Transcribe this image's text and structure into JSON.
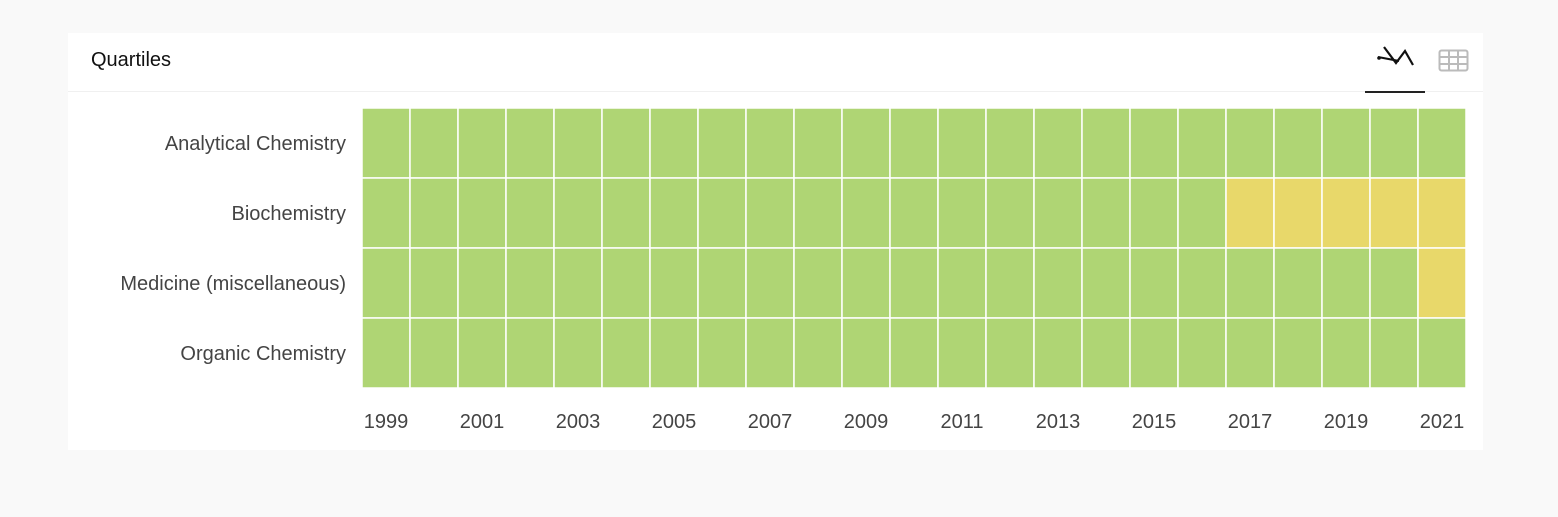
{
  "card": {
    "title": "Quartiles"
  },
  "toolbar": {
    "chart_view_icon": "line-chart-icon",
    "table_view_icon": "table-grid-icon",
    "active_view": "chart"
  },
  "chart_data": {
    "type": "heatmap",
    "title": "",
    "categories_y": [
      "Analytical Chemistry",
      "Biochemistry",
      "Medicine (miscellaneous)",
      "Organic Chemistry"
    ],
    "years": [
      1999,
      2000,
      2001,
      2002,
      2003,
      2004,
      2005,
      2006,
      2007,
      2008,
      2009,
      2010,
      2011,
      2012,
      2013,
      2014,
      2015,
      2016,
      2017,
      2018,
      2019,
      2020,
      2021
    ],
    "x_tick_labels": [
      "1999",
      "2001",
      "2003",
      "2005",
      "2007",
      "2009",
      "2011",
      "2013",
      "2015",
      "2017",
      "2019",
      "2021"
    ],
    "values": [
      [
        "Q1",
        "Q1",
        "Q1",
        "Q1",
        "Q1",
        "Q1",
        "Q1",
        "Q1",
        "Q1",
        "Q1",
        "Q1",
        "Q1",
        "Q1",
        "Q1",
        "Q1",
        "Q1",
        "Q1",
        "Q1",
        "Q1",
        "Q1",
        "Q1",
        "Q1",
        "Q1"
      ],
      [
        "Q1",
        "Q1",
        "Q1",
        "Q1",
        "Q1",
        "Q1",
        "Q1",
        "Q1",
        "Q1",
        "Q1",
        "Q1",
        "Q1",
        "Q1",
        "Q1",
        "Q1",
        "Q1",
        "Q1",
        "Q1",
        "Q2",
        "Q2",
        "Q2",
        "Q2",
        "Q2"
      ],
      [
        "Q1",
        "Q1",
        "Q1",
        "Q1",
        "Q1",
        "Q1",
        "Q1",
        "Q1",
        "Q1",
        "Q1",
        "Q1",
        "Q1",
        "Q1",
        "Q1",
        "Q1",
        "Q1",
        "Q1",
        "Q1",
        "Q1",
        "Q1",
        "Q1",
        "Q1",
        "Q2"
      ],
      [
        "Q1",
        "Q1",
        "Q1",
        "Q1",
        "Q1",
        "Q1",
        "Q1",
        "Q1",
        "Q1",
        "Q1",
        "Q1",
        "Q1",
        "Q1",
        "Q1",
        "Q1",
        "Q1",
        "Q1",
        "Q1",
        "Q1",
        "Q1",
        "Q1",
        "Q1",
        "Q1"
      ]
    ],
    "colors": {
      "Q1": "#afd574",
      "Q2": "#e8d86a",
      "Q3": "#fb8c52",
      "Q4": "#dd5a4e"
    },
    "legend": "none",
    "grid": false
  }
}
